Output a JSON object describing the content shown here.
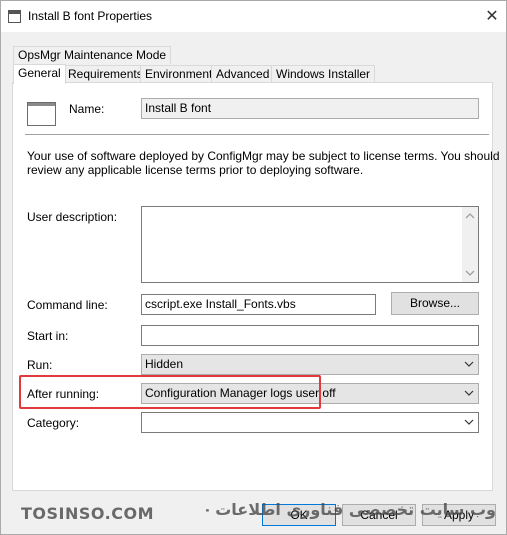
{
  "window": {
    "title": "Install B font Properties",
    "close_glyph": "✕"
  },
  "tabs": {
    "row_top": [
      "OpsMgr Maintenance Mode"
    ],
    "row_main": [
      "General",
      "Requirements",
      "Environment",
      "Advanced",
      "Windows Installer"
    ],
    "active": "General"
  },
  "general": {
    "name_label": "Name:",
    "name_value": "Install B font",
    "license_text_line1": "Your use of software deployed by ConfigMgr may be subject to license terms. You should",
    "license_text_line2": "review any applicable license terms prior to deploying software.",
    "user_description_label": "User description:",
    "user_description_value": "",
    "command_line_label": "Command line:",
    "command_line_value": "cscript.exe Install_Fonts.vbs",
    "browse_button": "Browse...",
    "start_in_label": "Start in:",
    "start_in_value": "",
    "run_label": "Run:",
    "run_value": "Hidden",
    "after_running_label": "After running:",
    "after_running_value": "Configuration Manager logs user off",
    "category_label": "Category:",
    "category_value": ""
  },
  "footer": {
    "ok_button": "OK",
    "cancel_button": "Cancel",
    "apply_button": "Apply"
  },
  "watermark": {
    "left_text": "TOSINSO.COM",
    "right_text": "وب سایت تخصصی فناوری اطلاعات - Tosinso.com"
  },
  "colors": {
    "highlight": "#e0393e",
    "dialog_bg": "#f0f0f0"
  }
}
